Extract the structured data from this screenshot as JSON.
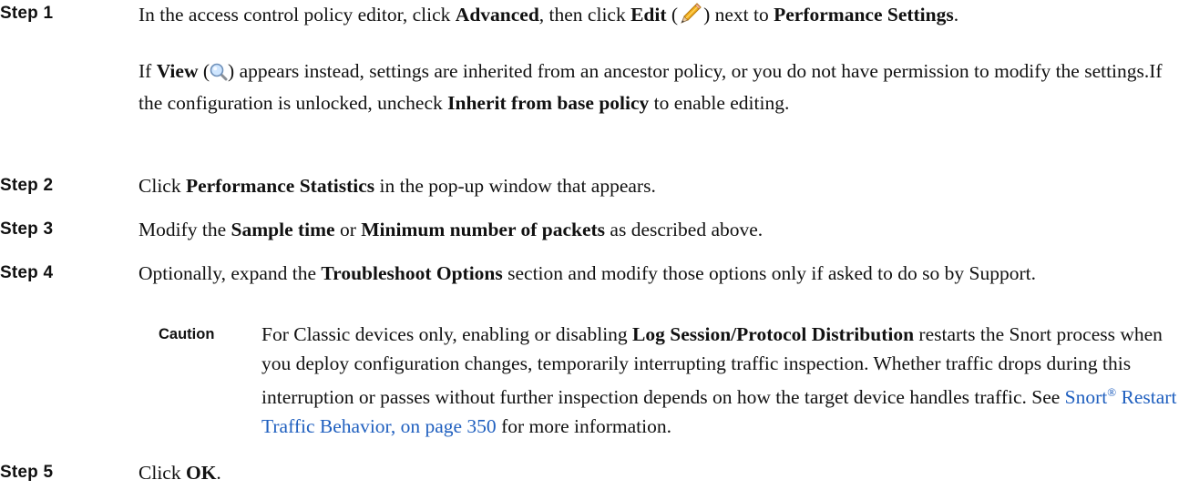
{
  "steps": [
    {
      "label": "Step 1",
      "line": [
        {
          "t": "In the access control policy editor, click "
        },
        {
          "b": "Advanced"
        },
        {
          "t": ", then click "
        },
        {
          "b": "Edit"
        },
        {
          "t": " ("
        },
        {
          "icon": "pencil-icon"
        },
        {
          "t": ") next to "
        },
        {
          "b": "Performance Settings"
        },
        {
          "t": "."
        }
      ],
      "note": [
        {
          "t": "If "
        },
        {
          "b": "View"
        },
        {
          "t": " ("
        },
        {
          "icon": "magnifier-icon"
        },
        {
          "t": ") appears instead, settings are inherited from an ancestor policy, or you do not have permission to modify the settings.If the configuration is unlocked, uncheck "
        },
        {
          "b": "Inherit from base policy"
        },
        {
          "t": " to enable editing."
        }
      ]
    },
    {
      "label": "Step 2",
      "line": [
        {
          "t": "Click "
        },
        {
          "b": "Performance Statistics"
        },
        {
          "t": " in the pop-up window that appears."
        }
      ]
    },
    {
      "label": "Step 3",
      "line": [
        {
          "t": "Modify the "
        },
        {
          "b": "Sample time"
        },
        {
          "t": " or "
        },
        {
          "b": "Minimum number of packets"
        },
        {
          "t": " as described above."
        }
      ]
    },
    {
      "label": "Step 4",
      "line": [
        {
          "t": "Optionally, expand the "
        },
        {
          "b": "Troubleshoot Options"
        },
        {
          "t": " section and modify those options only if asked to do so by Support."
        }
      ]
    },
    {
      "label": "Step 5",
      "line": [
        {
          "t": "Click "
        },
        {
          "b": "OK"
        },
        {
          "t": "."
        }
      ]
    }
  ],
  "caution": {
    "label": "Caution",
    "text": [
      {
        "t": "For Classic devices only, enabling  or disabling "
      },
      {
        "b": "Log Session/Protocol Distribution"
      },
      {
        "t": "  restarts the Snort process when you deploy configuration changes, temporarily interrupting traffic inspection. Whether traffic drops during this interruption or passes without further inspection depends on how the target device handles traffic. See "
      },
      {
        "link": "Snort",
        "sup": "®",
        "rest": " Restart Traffic Behavior, on page 350"
      },
      {
        "t": " for more information."
      }
    ]
  },
  "colors": {
    "link": "#1f5fbf",
    "text": "#111111"
  }
}
